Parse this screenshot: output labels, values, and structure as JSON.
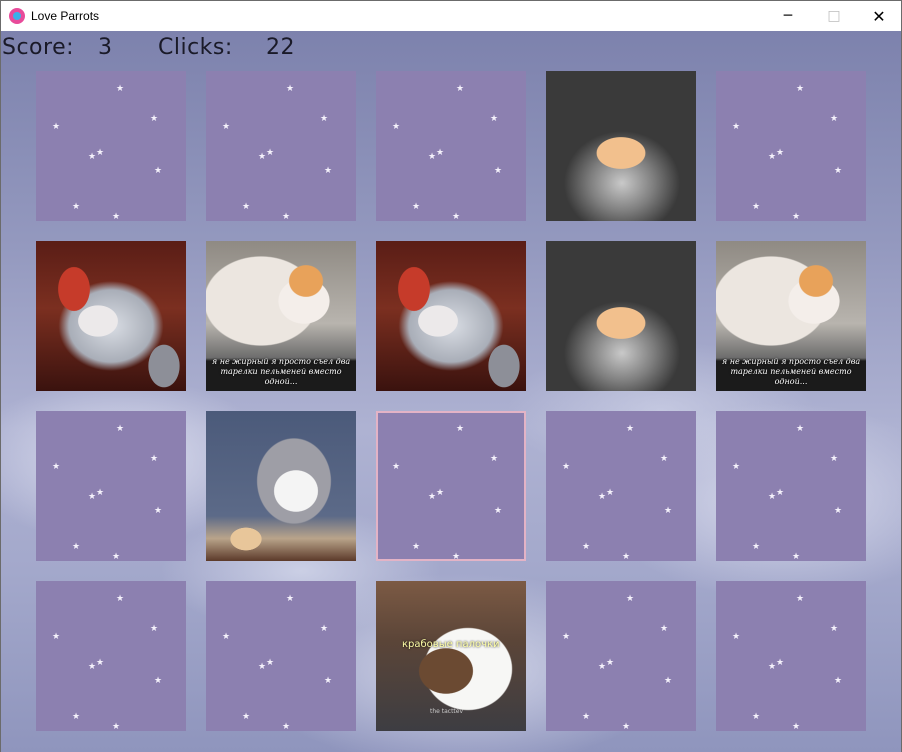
{
  "window": {
    "title": "Love Parrots",
    "minimize_glyph": "─",
    "maximize_glyph": "□",
    "close_glyph": "✕"
  },
  "hud": {
    "score_label": "Score:",
    "score_value": "3",
    "clicks_label": "Clicks:",
    "clicks_value": "22"
  },
  "board": {
    "card_back_color": "#8c80b0",
    "rows": [
      [
        {
          "state": "hidden"
        },
        {
          "state": "hidden"
        },
        {
          "state": "hidden"
        },
        {
          "state": "revealed",
          "image": "cat-in-kettle"
        },
        {
          "state": "hidden"
        }
      ],
      [
        {
          "state": "revealed",
          "image": "cat-in-jar"
        },
        {
          "state": "revealed",
          "image": "fat-cat-on-scale",
          "caption": "я не жирный я просто съел два тарелки пельменей вместо одной..."
        },
        {
          "state": "revealed",
          "image": "cat-in-jar"
        },
        {
          "state": "revealed",
          "image": "cat-in-kettle"
        },
        {
          "state": "revealed",
          "image": "fat-cat-on-scale",
          "caption": "я не жирный я просто съел два тарелки пельменей вместо одной..."
        }
      ],
      [
        {
          "state": "hidden"
        },
        {
          "state": "revealed",
          "image": "gray-white-cat"
        },
        {
          "state": "hidden",
          "selected": true
        },
        {
          "state": "hidden"
        },
        {
          "state": "hidden"
        }
      ],
      [
        {
          "state": "hidden"
        },
        {
          "state": "hidden"
        },
        {
          "state": "revealed",
          "image": "cats-hugging",
          "caption": "крабовые палочки",
          "watermark": "the tacttev"
        },
        {
          "state": "hidden"
        },
        {
          "state": "hidden"
        }
      ]
    ]
  }
}
